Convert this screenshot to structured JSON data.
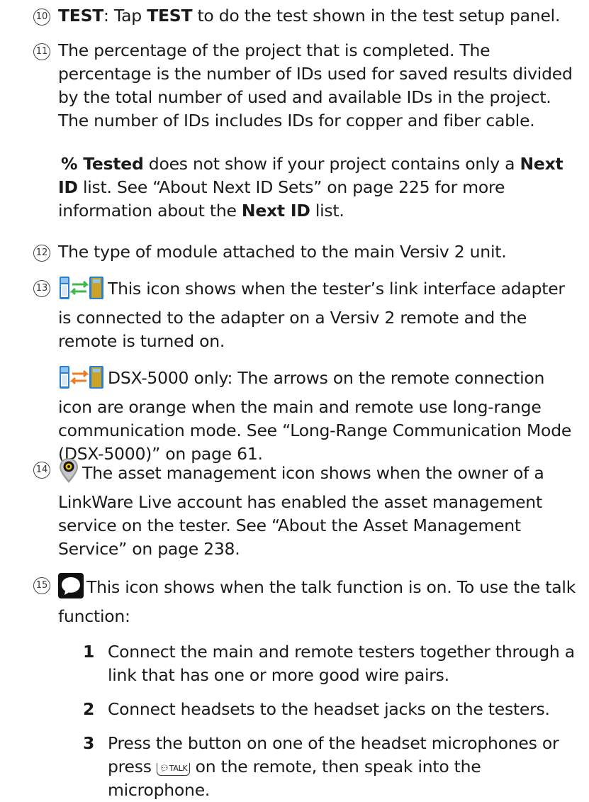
{
  "items": [
    {
      "number": "10",
      "label": "TEST",
      "text_before_bold": ": Tap ",
      "bold2": "TEST",
      "text_after": " to do the test shown in the test setup panel."
    },
    {
      "number": "11",
      "text": "The percentage of the project that is completed. The percentage is the number of IDs used for saved results divided by the total number of used and available IDs in the project. The number of IDs includes IDs for copper and fiber cable.",
      "note_bold1": "% Tested",
      "note_text1": " does not show if your project contains only a ",
      "note_bold2": "Next ID",
      "note_text2": " list. See “About Next ID Sets” on page 225 for more information about the ",
      "note_bold3": "Next ID",
      "note_text3": " list."
    },
    {
      "number": "12",
      "text": "The type of module attached to the main Versiv 2 unit."
    },
    {
      "number": "13",
      "icon": "remote-connected-icon",
      "text": "This icon shows when the tester’s link interface adapter is connected to the adapter on a Versiv 2 remote and the remote is turned on.",
      "note_icon": "long-range-remote-icon",
      "note_text": "DSX-5000 only: The arrows on the remote connection icon are orange when the main and remote use long-range communication mode. See “Long-Range Communication Mode (DSX-5000)” on page 61."
    },
    {
      "number": "14",
      "icon": "asset-management-icon",
      "text": "The asset management icon shows when the owner of a LinkWare Live account has enabled the asset management service on the tester. See “About the Asset Management Service” on page 238."
    },
    {
      "number": "15",
      "icon": "talk-bubble-icon",
      "text": "This icon shows when the talk function is on. To use the talk function:",
      "steps": [
        {
          "num": "1",
          "text": "Connect the main and remote testers together through a link that has one or more good wire pairs."
        },
        {
          "num": "2",
          "text": "Connect headsets to the headset jacks on the testers."
        },
        {
          "num": "3",
          "text_before": "Press the button on one of the headset microphones or press ",
          "key": "TALK",
          "text_after": " on the remote, then speak into the microphone."
        }
      ]
    }
  ],
  "colors": {
    "text": "#1a1a1a",
    "arrow_green": "#3cb94a",
    "arrow_orange": "#f07a22",
    "device_blue": "#2a7fd4",
    "device_gold": "#c9a227",
    "bubble_black": "#111111"
  }
}
